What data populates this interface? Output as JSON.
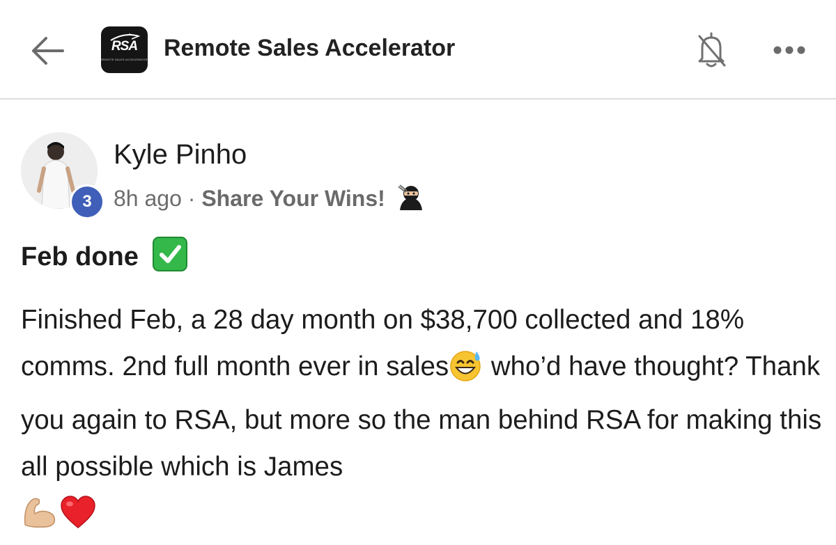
{
  "header": {
    "group_name": "Remote Sales Accelerator",
    "logo_text": "RSA",
    "logo_subtext": "REMOTE SALES ACCELERATOR",
    "icons": [
      "back-arrow-icon",
      "bell-off-icon",
      "more-dots-icon"
    ]
  },
  "post": {
    "author": "Kyle Pinho",
    "level": "3",
    "time": "8h ago",
    "separator": "·",
    "category": "Share Your Wins!",
    "title": "Feb done",
    "body_part1": "Finished Feb, a 28 day month on $38,700 collected and 18% comms. 2nd full month ever in sales",
    "body_part2": " who’d have thought? Thank you again to RSA, but more so the man behind RSA for making this all possible which is James",
    "emojis": [
      "ninja",
      "check-mark-button",
      "grinning-sweat",
      "flexed-biceps",
      "red-heart"
    ]
  },
  "colors": {
    "level_badge": "#3f5fb8",
    "check_green": "#34b84a",
    "divider": "#dedede"
  }
}
